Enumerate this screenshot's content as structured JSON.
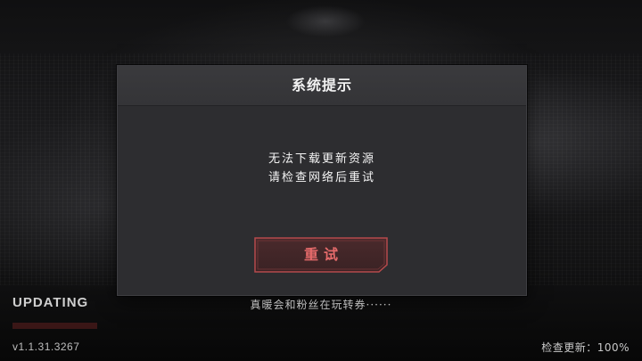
{
  "dialog": {
    "title": "系统提示",
    "message_line1": "无法下载更新资源",
    "message_line2": "请检查网络后重试",
    "retry_label": "重试"
  },
  "hud": {
    "updating_label": "UPDATING",
    "progress": 0,
    "tip": "真暖会和粉丝在玩转券······",
    "version": "v1.1.31.3267",
    "update_status": "检查更新：100%"
  },
  "colors": {
    "dialog_bg": "#2d2d30",
    "accent_red": "#e66b6b",
    "progress_fill": "#6e2020"
  }
}
